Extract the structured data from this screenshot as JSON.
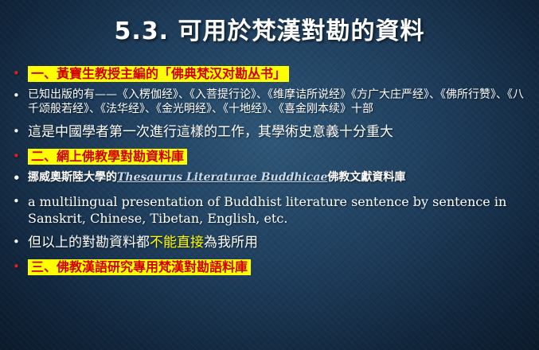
{
  "slide": {
    "title": "5.3.  可用於梵漢對勘的資料",
    "items": [
      {
        "text": "一、黃寶生教授主編的「佛典梵汉对勘丛书」"
      },
      {
        "text": "已知出版的有——《入楞伽经》、《入菩提行论》、《维摩诘所说经》《方广大庄严经》、《佛所行赞》、《八千颂般若经》、《法华经》、《金光明经》、《十地经》、《喜金刚本续》十部"
      },
      {
        "text": "這是中國學者第一次進行這樣的工作，其學術史意義十分重大"
      },
      {
        "text": "二、網上佛教學對勘資料庫"
      },
      {
        "prefix": "挪威奧斯陸大學的",
        "link": "Thesaurus Literaturae Buddhicae",
        "suffix": "佛教文獻資料庫"
      },
      {
        "text": "a multilingual presentation of Buddhist literature sentence by sentence in Sanskrit, Chinese, Tibetan, English, etc."
      },
      {
        "prefix": "但以上的對勘資料都",
        "highlight": "不能直接",
        "suffix": "為我所用"
      },
      {
        "text": "三、佛教漢語研究專用梵漢對勘語料庫"
      }
    ]
  },
  "colors": {
    "background": "#1e3d5c",
    "highlight_bg": "#ffff00",
    "highlight_text": "#d00000",
    "red_bullet": "#e0201b",
    "text": "#ffffff",
    "yellow_text": "#ffff00"
  }
}
